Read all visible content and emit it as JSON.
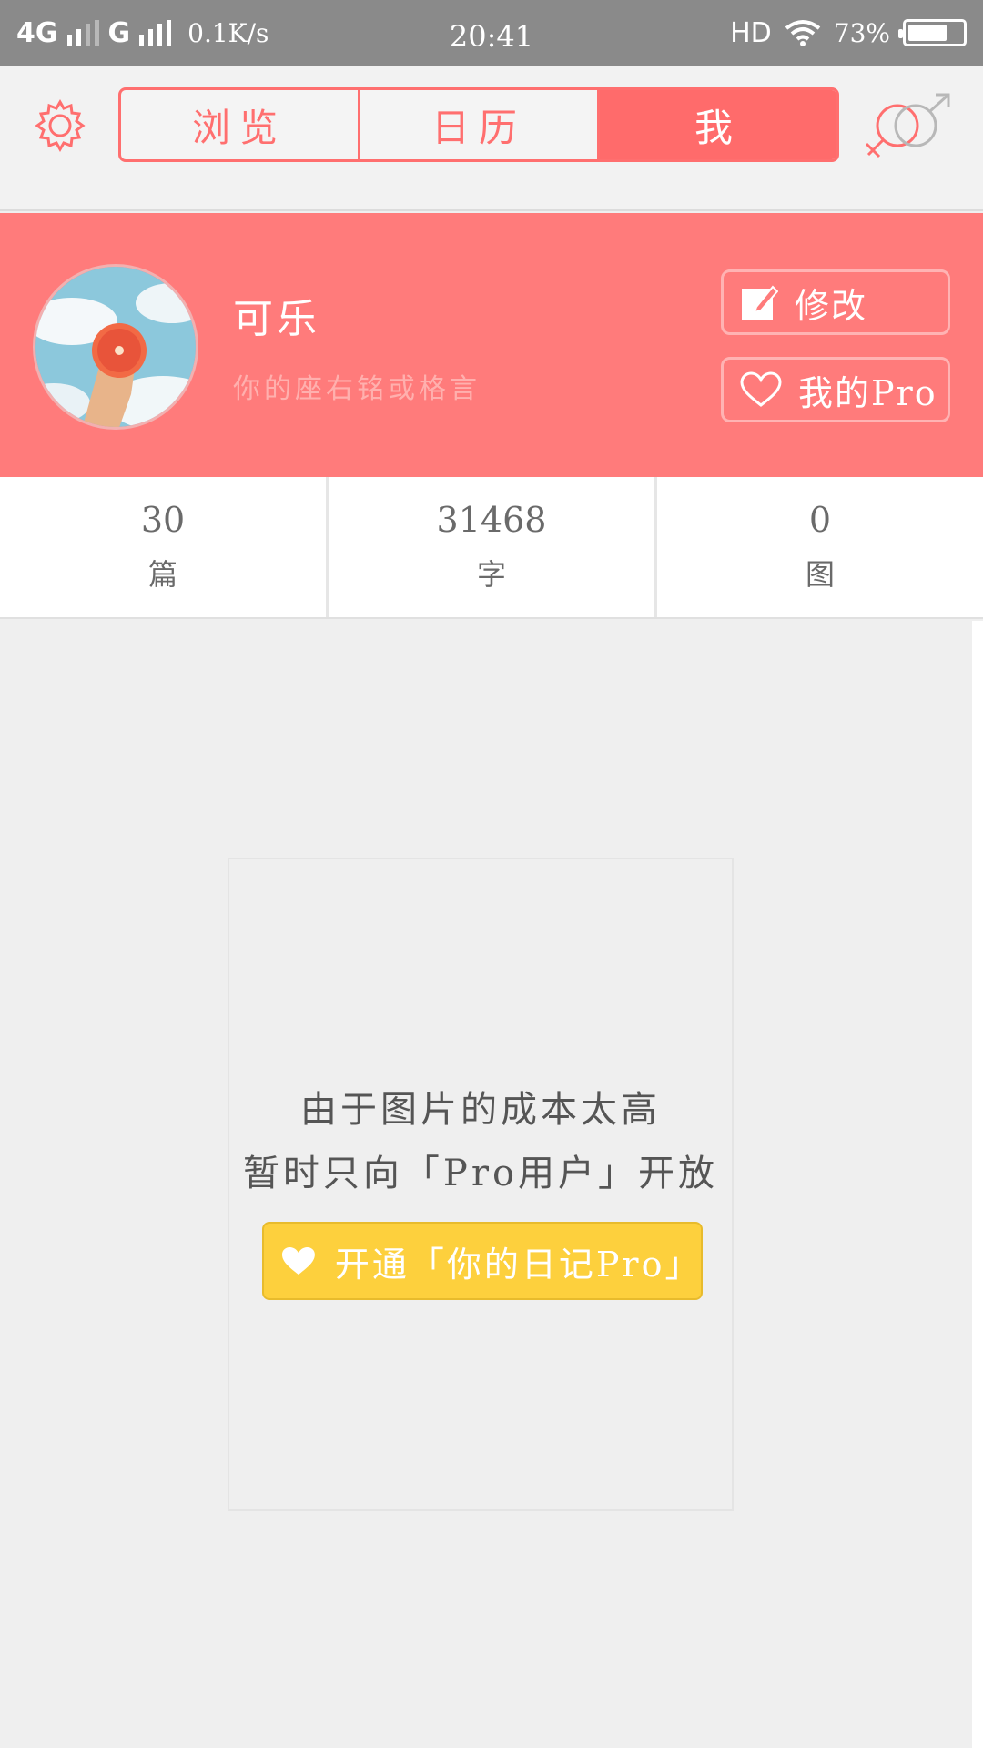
{
  "status_bar": {
    "network1": "4G",
    "network2": "G",
    "speed": "0.1K/s",
    "time": "20:41",
    "hd": "HD",
    "battery_pct": "73%",
    "battery_level": 0.73
  },
  "header": {
    "tabs": [
      {
        "label": "浏览",
        "active": false
      },
      {
        "label": "日历",
        "active": false
      },
      {
        "label": "我",
        "active": true
      }
    ],
    "settings_icon": "gear-icon",
    "gender_icon": "gender-icon"
  },
  "profile": {
    "name": "可乐",
    "motto_placeholder": "你的座右铭或格言",
    "edit_label": "修改",
    "pro_label": "我的Pro"
  },
  "stats": [
    {
      "value": "30",
      "unit": "篇"
    },
    {
      "value": "31468",
      "unit": "字"
    },
    {
      "value": "0",
      "unit": "图"
    }
  ],
  "gallery_notice": {
    "line1": "由于图片的成本太高",
    "line2": "暂时只向「Pro用户」开放",
    "button_label": "开通「你的日记Pro」"
  },
  "colors": {
    "accent": "#ff6f6f",
    "banner": "#ff7b7b",
    "pro_button": "#fdd03d"
  }
}
